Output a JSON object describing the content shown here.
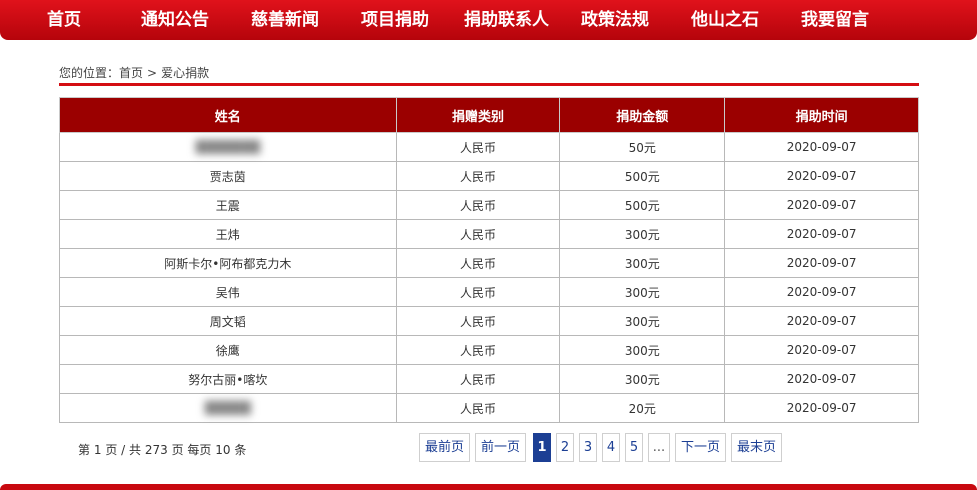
{
  "nav": {
    "items": [
      "首页",
      "通知公告",
      "慈善新闻",
      "项目捐助",
      "捐助联系人",
      "政策法规",
      "他山之石",
      "我要留言"
    ]
  },
  "breadcrumb": {
    "prefix": "您的位置：",
    "home": "首页",
    "separator": ">",
    "current": "爱心捐款"
  },
  "table": {
    "headers": [
      "姓名",
      "捐赠类别",
      "捐助金额",
      "捐助时间"
    ],
    "rows": [
      [
        "",
        "人民币",
        "50元",
        "2020-09-07"
      ],
      [
        "贾志茵",
        "人民币",
        "500元",
        "2020-09-07"
      ],
      [
        "王震",
        "人民币",
        "500元",
        "2020-09-07"
      ],
      [
        "王炜",
        "人民币",
        "300元",
        "2020-09-07"
      ],
      [
        "阿斯卡尔•阿布都克力木",
        "人民币",
        "300元",
        "2020-09-07"
      ],
      [
        "吴伟",
        "人民币",
        "300元",
        "2020-09-07"
      ],
      [
        "周文韬",
        "人民币",
        "300元",
        "2020-09-07"
      ],
      [
        "徐鹰",
        "人民币",
        "300元",
        "2020-09-07"
      ],
      [
        "努尔古丽•喀坎",
        "人民币",
        "300元",
        "2020-09-07"
      ],
      [
        "",
        "人民币",
        "20元",
        "2020-09-07"
      ]
    ]
  },
  "pagination": {
    "info": {
      "prefix": "第",
      "current": "1",
      "mid1": "页 / 共",
      "total_pages": "273",
      "mid2": "页 每页",
      "per_page": "10",
      "suffix": "条"
    },
    "first": "最前页",
    "prev": "前一页",
    "pages": [
      "1",
      "2",
      "3",
      "4",
      "5"
    ],
    "active_page": "1",
    "ellipsis": "...",
    "next": "下一页",
    "last": "最末页"
  },
  "colors": {
    "nav_red": "#c8080f",
    "header_red": "#9b0000",
    "link_blue": "#1c3f94"
  }
}
